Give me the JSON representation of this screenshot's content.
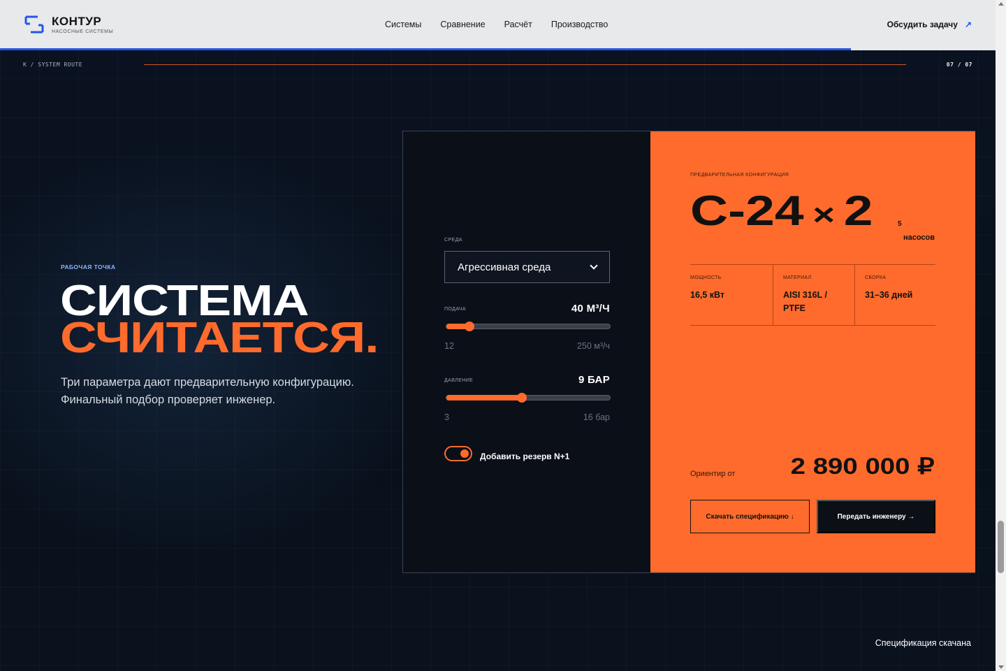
{
  "header": {
    "logo_name": "КОНТУР",
    "logo_sub": "НАСОСНЫЕ СИСТЕМЫ",
    "nav": [
      "Системы",
      "Сравнение",
      "Расчёт",
      "Производство"
    ],
    "cta": "Обсудить задачу",
    "scroll_progress": 0.855,
    "accent": "#2456e8"
  },
  "route": {
    "path": "K / SYSTEM ROUTE",
    "counter": "07 / 07"
  },
  "hero": {
    "eyebrow": "РАБОЧАЯ ТОЧКА",
    "title_line1": "СИСТЕМА",
    "title_line2": "СЧИТАЕТСЯ.",
    "description": "Три параметра дают предварительную конфигурацию. Финальный подбор проверяет инженер."
  },
  "form": {
    "medium_label": "СРЕДА",
    "medium_value": "Агрессивная среда",
    "flow": {
      "label": "ПОДАЧА",
      "value_display": "40 М³/Ч",
      "min_label": "12",
      "max_label": "250 м³/ч",
      "value": 40,
      "min": 12,
      "max": 250
    },
    "pressure": {
      "label": "ДАВЛЕНИЕ",
      "value_display": "9 БАР",
      "min_label": "3",
      "max_label": "16 бар",
      "value": 9,
      "min": 3,
      "max": 16
    },
    "reserve_toggle_label": "Добавить резерв N+1",
    "reserve_enabled": true
  },
  "result": {
    "pre_label": "ПРЕДВАРИТЕЛЬНАЯ КОНФИГУРАЦИЯ",
    "model": "С-24",
    "multiplier": "×",
    "count": "2",
    "count_sub": "5",
    "count_word": "насосов",
    "specs": [
      {
        "key": "МОЩНОСТЬ",
        "value": "16,5 кВт"
      },
      {
        "key": "МАТЕРИАЛ",
        "value": "AISI 316L / PTFE"
      },
      {
        "key": "СБОРКА",
        "value": "31–36 дней"
      }
    ],
    "price_label": "Ориентир от",
    "price": "2 890 000 ₽",
    "download_button": "Скачать спецификацию ↓",
    "send_button": "Передать инженеру →",
    "accent": "#ff6b2c"
  },
  "toast": "Спецификация скачана"
}
